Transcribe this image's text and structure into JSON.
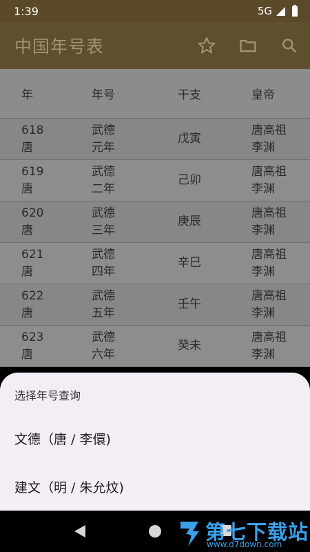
{
  "status": {
    "time": "1:39",
    "network": "5G"
  },
  "appbar": {
    "title": "中国年号表"
  },
  "table": {
    "headers": [
      "年",
      "年号",
      "干支",
      "皇帝"
    ],
    "rows": [
      {
        "year": "618",
        "dynasty": "唐",
        "era1": "武德",
        "era2": "元年",
        "ganzhi": "戊寅",
        "emp1": "唐高祖",
        "emp2": "李渊"
      },
      {
        "year": "619",
        "dynasty": "唐",
        "era1": "武德",
        "era2": "二年",
        "ganzhi": "己卯",
        "emp1": "唐高祖",
        "emp2": "李渊"
      },
      {
        "year": "620",
        "dynasty": "唐",
        "era1": "武德",
        "era2": "三年",
        "ganzhi": "庚辰",
        "emp1": "唐高祖",
        "emp2": "李渊"
      },
      {
        "year": "621",
        "dynasty": "唐",
        "era1": "武德",
        "era2": "四年",
        "ganzhi": "辛巳",
        "emp1": "唐高祖",
        "emp2": "李渊"
      },
      {
        "year": "622",
        "dynasty": "唐",
        "era1": "武德",
        "era2": "五年",
        "ganzhi": "壬午",
        "emp1": "唐高祖",
        "emp2": "李渊"
      },
      {
        "year": "623",
        "dynasty": "唐",
        "era1": "武德",
        "era2": "六年",
        "ganzhi": "癸未",
        "emp1": "唐高祖",
        "emp2": "李渊"
      }
    ]
  },
  "sheet": {
    "title": "选择年号查询",
    "items": [
      "文德（唐 / 李儇)",
      "建文（明 / 朱允炆)"
    ]
  },
  "watermark": {
    "brand": "第七下载站",
    "url": "www.d7down.com"
  }
}
